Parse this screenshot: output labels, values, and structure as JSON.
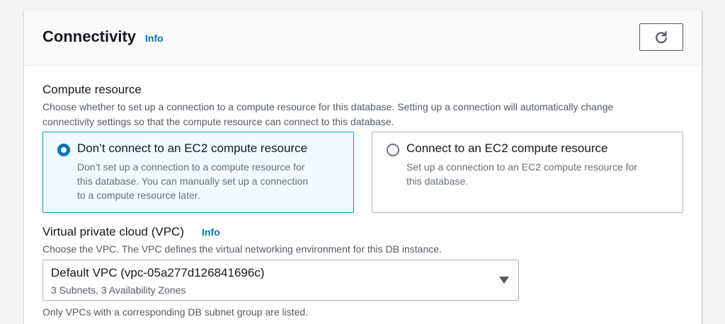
{
  "header": {
    "title": "Connectivity",
    "info_label": "Info"
  },
  "compute": {
    "label": "Compute resource",
    "description_line1": "Choose whether to set up a connection to a compute resource for this database. Setting up a connection will automatically change",
    "description_line2": "connectivity settings so that the compute resource can connect to this database.",
    "options": [
      {
        "title": "Don’t connect to an EC2 compute resource",
        "desc_lines": [
          "Don’t set up a connection to a compute resource for",
          "this database. You can manually set up a connection",
          "to a compute resource later."
        ],
        "selected": true
      },
      {
        "title": "Connect to an EC2 compute resource",
        "desc_lines": [
          "Set up a connection to an EC2 compute resource for",
          "this database."
        ],
        "selected": false
      }
    ]
  },
  "vpc": {
    "label": "Virtual private cloud (VPC)",
    "info_label": "Info",
    "description": "Choose the VPC. The VPC defines the virtual networking environment for this DB instance.",
    "selected_value": "Default VPC (vpc-05a277d126841696c)",
    "selected_sub": "3 Subnets, 3 Availability Zones",
    "hint": "Only VPCs with a corresponding DB subnet group are listed."
  },
  "icons": {
    "refresh": "refresh-icon",
    "dropdown": "caret-down-icon"
  },
  "colors": {
    "accent": "#0073bb",
    "selected_border": "#00a1c9",
    "selected_bg": "#f1faff"
  }
}
